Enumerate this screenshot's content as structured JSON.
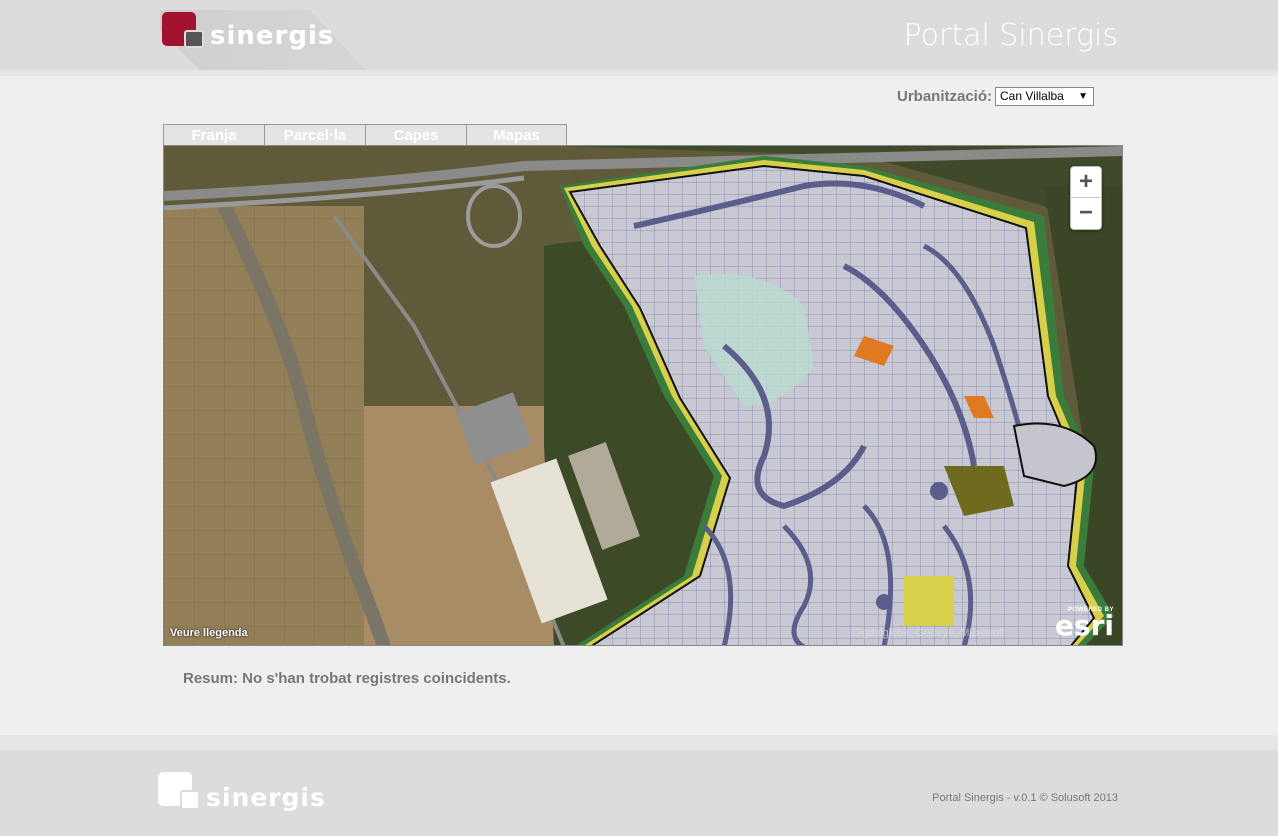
{
  "header": {
    "logo_text": "sinergis",
    "title": "Portal Sinergis"
  },
  "filter": {
    "label": "Urbanització:",
    "selected": "Can Villalba"
  },
  "tabs": [
    {
      "label": "Franja"
    },
    {
      "label": "Parcel·la"
    },
    {
      "label": "Capes"
    },
    {
      "label": "Mapas"
    }
  ],
  "map": {
    "zoom_in": "+",
    "zoom_out": "−",
    "legend_link": "Veure llegenda",
    "attribution": "Digitalglobe, Geoeye, Microsoft",
    "esri_powered": "POWERED BY",
    "esri_brand": "esri"
  },
  "summary": "Resum: No s'han trobat registres coincidents.",
  "footer": {
    "logo_text": "sinergis",
    "copyright": "Portal Sinergis - v.0.1 © Solusoft 2013"
  },
  "colors": {
    "brand_red": "#a3122e",
    "header_bg": "#dcdcdc",
    "page_bg": "#efefef"
  }
}
